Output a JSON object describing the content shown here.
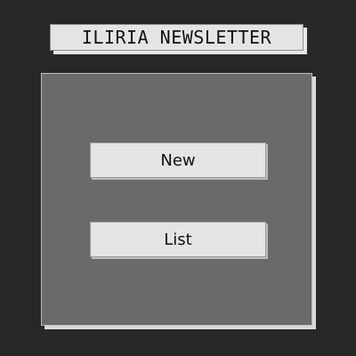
{
  "header": {
    "title": "ILIRIA NEWSLETTER"
  },
  "menu": {
    "buttons": [
      {
        "label": "New"
      },
      {
        "label": "List"
      }
    ]
  },
  "colors": {
    "background": "#272928",
    "panel": "#696b68",
    "button_face": "#e4e4e6",
    "text": "#111111"
  }
}
